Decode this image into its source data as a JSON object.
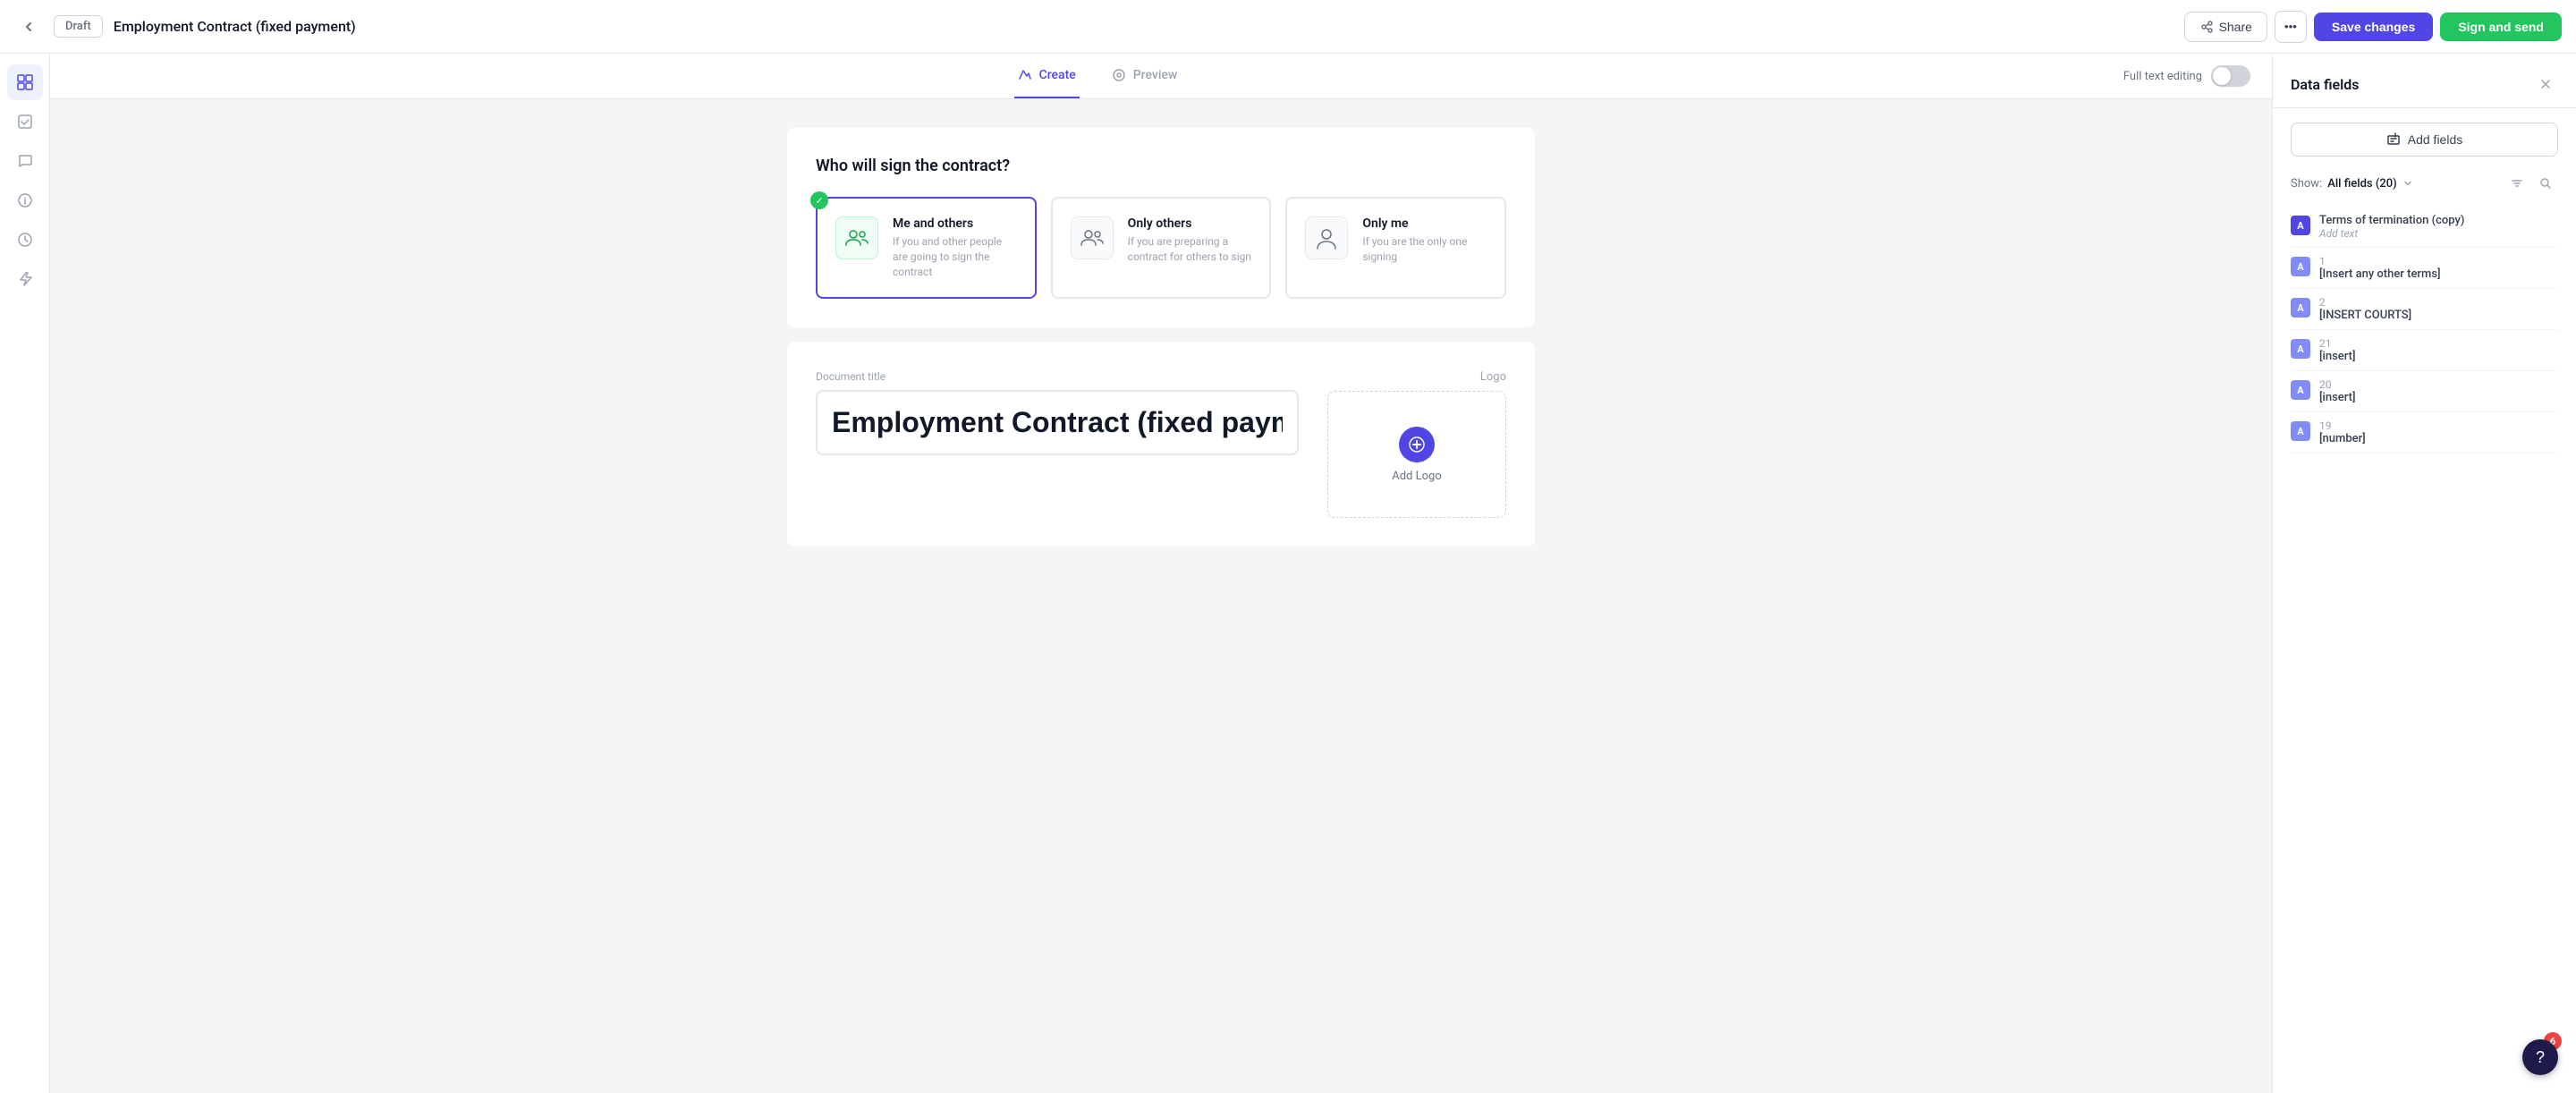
{
  "topbar": {
    "back_label": "←",
    "draft_label": "Draft",
    "document_title": "Employment Contract (fixed payment)",
    "share_label": "Share",
    "more_label": "•••",
    "save_changes_label": "Save changes",
    "sign_send_label": "Sign and send"
  },
  "tabs": {
    "create_label": "Create",
    "preview_label": "Preview",
    "full_text_editing_label": "Full text editing"
  },
  "signing": {
    "question": "Who will sign the contract?",
    "options": [
      {
        "id": "me_and_others",
        "label": "Me and others",
        "description": "If you and other people are going to sign the contract",
        "selected": true
      },
      {
        "id": "only_others",
        "label": "Only others",
        "description": "If you are preparing a contract for others to sign",
        "selected": false
      },
      {
        "id": "only_me",
        "label": "Only me",
        "description": "If you are the only one signing",
        "selected": false
      }
    ]
  },
  "document": {
    "title_label": "Document title",
    "title_value": "Employment Contract (fixed payment)",
    "logo_label": "Logo",
    "add_logo_label": "Add Logo"
  },
  "panel": {
    "title": "Data fields",
    "close_label": "×",
    "add_fields_label": "Add fields",
    "show_label": "Show:",
    "filter_value": "All fields (20)",
    "fields": [
      {
        "id": "field-1",
        "number": "",
        "name": "Terms of termination (copy)",
        "placeholder": "Add text"
      },
      {
        "id": "field-2",
        "number": "1",
        "name": "[Insert any other terms]",
        "placeholder": ""
      },
      {
        "id": "field-3",
        "number": "2",
        "name": "[INSERT COURTS]",
        "placeholder": ""
      },
      {
        "id": "field-4",
        "number": "21",
        "name": "[insert]",
        "placeholder": ""
      },
      {
        "id": "field-5",
        "number": "20",
        "name": "[insert]",
        "placeholder": ""
      },
      {
        "id": "field-6",
        "number": "19",
        "name": "[number]",
        "placeholder": ""
      }
    ]
  },
  "help": {
    "badge_count": "6",
    "icon": "?"
  },
  "icons": {
    "sidebar": [
      {
        "name": "layout-icon",
        "glyph": "⊞"
      },
      {
        "name": "check-icon",
        "glyph": "✓"
      },
      {
        "name": "chat-icon",
        "glyph": "💬"
      },
      {
        "name": "info-icon",
        "glyph": "ℹ"
      },
      {
        "name": "history-icon",
        "glyph": "⏱"
      },
      {
        "name": "lightning-icon",
        "glyph": "⚡"
      }
    ]
  }
}
